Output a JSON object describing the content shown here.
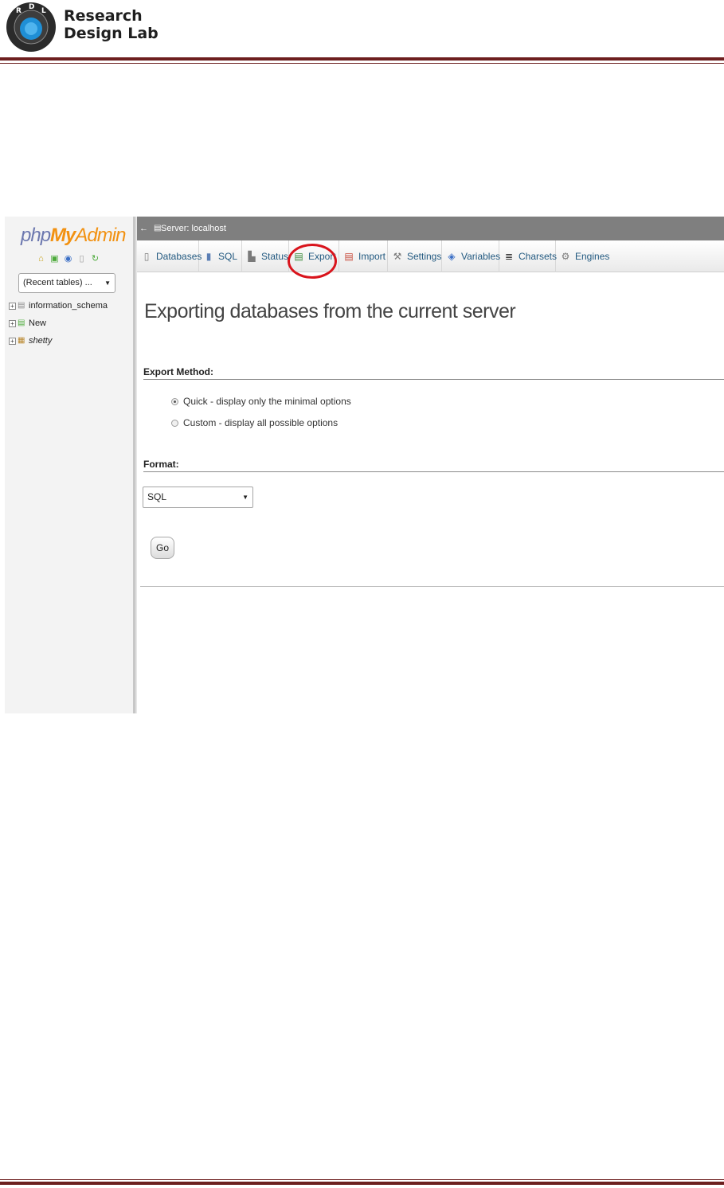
{
  "doc": {
    "brand_line1": "Research",
    "brand_line2": "Design Lab",
    "logo_letters": [
      "R",
      "D",
      "L"
    ],
    "accent_color": "#6d1f1f"
  },
  "pma": {
    "logo": {
      "php": "php",
      "my": "My",
      "admin": "Admin"
    },
    "nav_icons": [
      "home-icon",
      "logout-icon",
      "query-window-icon",
      "docs-icon",
      "reload-icon"
    ],
    "recent_tables": "(Recent tables) ...",
    "tree": [
      {
        "label": "information_schema",
        "icon": "database-icon",
        "italic": false
      },
      {
        "label": "New",
        "icon": "new-database-icon",
        "italic": false
      },
      {
        "label": "shetty",
        "icon": "database-tables-icon",
        "italic": true
      }
    ],
    "breadcrumb": {
      "back": "←",
      "server": "Server: localhost"
    },
    "tabs": [
      {
        "label": "Databases",
        "icon": "database-icon"
      },
      {
        "label": "SQL",
        "icon": "sql-icon"
      },
      {
        "label": "Status",
        "icon": "status-icon"
      },
      {
        "label": "Export",
        "icon": "export-icon"
      },
      {
        "label": "Import",
        "icon": "import-icon"
      },
      {
        "label": "Settings",
        "icon": "wrench-icon"
      },
      {
        "label": "Variables",
        "icon": "variables-icon"
      },
      {
        "label": "Charsets",
        "icon": "charsets-icon"
      },
      {
        "label": "Engines",
        "icon": "engines-icon"
      }
    ],
    "highlighted_tab": "Export",
    "main": {
      "title": "Exporting databases from the current server",
      "export_method_label": "Export Method:",
      "options": [
        {
          "label": "Quick - display only the minimal options",
          "checked": true
        },
        {
          "label": "Custom - display all possible options",
          "checked": false
        }
      ],
      "format_label": "Format:",
      "format_value": "SQL",
      "go_label": "Go"
    }
  }
}
